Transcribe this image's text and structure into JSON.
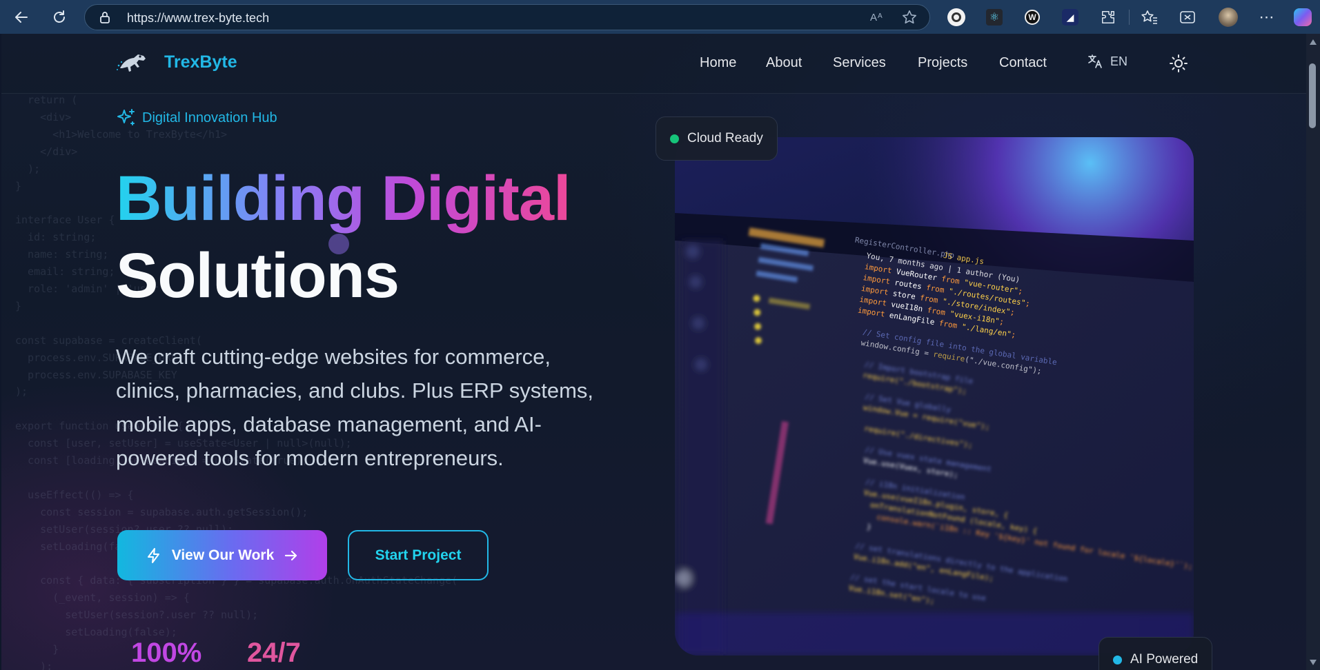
{
  "browser": {
    "url": "https://www.trex-byte.tech"
  },
  "nav": {
    "brand": "TrexByte",
    "links": [
      "Home",
      "About",
      "Services",
      "Projects",
      "Contact"
    ],
    "lang": "EN"
  },
  "hero": {
    "eyebrow": "Digital Innovation Hub",
    "title_line1": "Building Digital",
    "title_line2": "Solutions",
    "description": "We craft cutting-edge websites for commerce, clinics, pharmacies, and clubs. Plus ERP systems, mobile apps, database management, and AI-powered tools for modern entrepreneurs.",
    "primary_button": "View Our Work",
    "secondary_button": "Start Project",
    "stats": [
      "100%",
      "24/7"
    ]
  },
  "badges": {
    "cloud": "Cloud Ready",
    "ai": "AI Powered"
  },
  "colors": {
    "accent_cyan": "#22b8e6",
    "accent_pink": "#ec4899",
    "accent_purple": "#b13fe9",
    "status_green": "#16c47a"
  }
}
